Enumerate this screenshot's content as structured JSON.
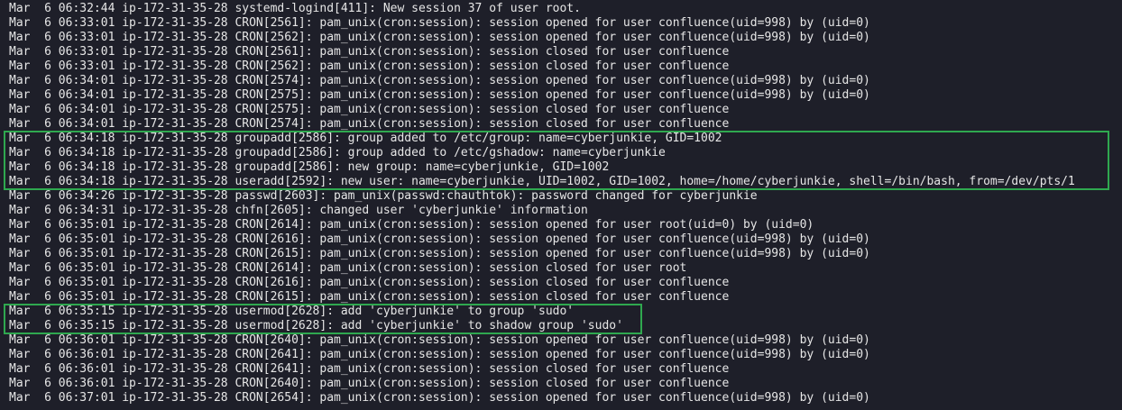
{
  "terminal": {
    "lines": [
      "Mar  6 06:32:44 ip-172-31-35-28 systemd-logind[411]: New session 37 of user root.",
      "Mar  6 06:33:01 ip-172-31-35-28 CRON[2561]: pam_unix(cron:session): session opened for user confluence(uid=998) by (uid=0)",
      "Mar  6 06:33:01 ip-172-31-35-28 CRON[2562]: pam_unix(cron:session): session opened for user confluence(uid=998) by (uid=0)",
      "Mar  6 06:33:01 ip-172-31-35-28 CRON[2561]: pam_unix(cron:session): session closed for user confluence",
      "Mar  6 06:33:01 ip-172-31-35-28 CRON[2562]: pam_unix(cron:session): session closed for user confluence",
      "Mar  6 06:34:01 ip-172-31-35-28 CRON[2574]: pam_unix(cron:session): session opened for user confluence(uid=998) by (uid=0)",
      "Mar  6 06:34:01 ip-172-31-35-28 CRON[2575]: pam_unix(cron:session): session opened for user confluence(uid=998) by (uid=0)",
      "Mar  6 06:34:01 ip-172-31-35-28 CRON[2575]: pam_unix(cron:session): session closed for user confluence",
      "Mar  6 06:34:01 ip-172-31-35-28 CRON[2574]: pam_unix(cron:session): session closed for user confluence",
      "Mar  6 06:34:18 ip-172-31-35-28 groupadd[2586]: group added to /etc/group: name=cyberjunkie, GID=1002",
      "Mar  6 06:34:18 ip-172-31-35-28 groupadd[2586]: group added to /etc/gshadow: name=cyberjunkie",
      "Mar  6 06:34:18 ip-172-31-35-28 groupadd[2586]: new group: name=cyberjunkie, GID=1002",
      "Mar  6 06:34:18 ip-172-31-35-28 useradd[2592]: new user: name=cyberjunkie, UID=1002, GID=1002, home=/home/cyberjunkie, shell=/bin/bash, from=/dev/pts/1",
      "Mar  6 06:34:26 ip-172-31-35-28 passwd[2603]: pam_unix(passwd:chauthtok): password changed for cyberjunkie",
      "Mar  6 06:34:31 ip-172-31-35-28 chfn[2605]: changed user 'cyberjunkie' information",
      "Mar  6 06:35:01 ip-172-31-35-28 CRON[2614]: pam_unix(cron:session): session opened for user root(uid=0) by (uid=0)",
      "Mar  6 06:35:01 ip-172-31-35-28 CRON[2616]: pam_unix(cron:session): session opened for user confluence(uid=998) by (uid=0)",
      "Mar  6 06:35:01 ip-172-31-35-28 CRON[2615]: pam_unix(cron:session): session opened for user confluence(uid=998) by (uid=0)",
      "Mar  6 06:35:01 ip-172-31-35-28 CRON[2614]: pam_unix(cron:session): session closed for user root",
      "Mar  6 06:35:01 ip-172-31-35-28 CRON[2616]: pam_unix(cron:session): session closed for user confluence",
      "Mar  6 06:35:01 ip-172-31-35-28 CRON[2615]: pam_unix(cron:session): session closed for user confluence",
      "Mar  6 06:35:15 ip-172-31-35-28 usermod[2628]: add 'cyberjunkie' to group 'sudo'",
      "Mar  6 06:35:15 ip-172-31-35-28 usermod[2628]: add 'cyberjunkie' to shadow group 'sudo'",
      "Mar  6 06:36:01 ip-172-31-35-28 CRON[2640]: pam_unix(cron:session): session opened for user confluence(uid=998) by (uid=0)",
      "Mar  6 06:36:01 ip-172-31-35-28 CRON[2641]: pam_unix(cron:session): session opened for user confluence(uid=998) by (uid=0)",
      "Mar  6 06:36:01 ip-172-31-35-28 CRON[2641]: pam_unix(cron:session): session closed for user confluence",
      "Mar  6 06:36:01 ip-172-31-35-28 CRON[2640]: pam_unix(cron:session): session closed for user confluence",
      "Mar  6 06:37:01 ip-172-31-35-28 CRON[2654]: pam_unix(cron:session): session opened for user confluence(uid=998) by (uid=0)"
    ]
  },
  "colors": {
    "background": "#1e1f29",
    "text": "#e6e6e6",
    "highlight": "#2fa84f"
  }
}
